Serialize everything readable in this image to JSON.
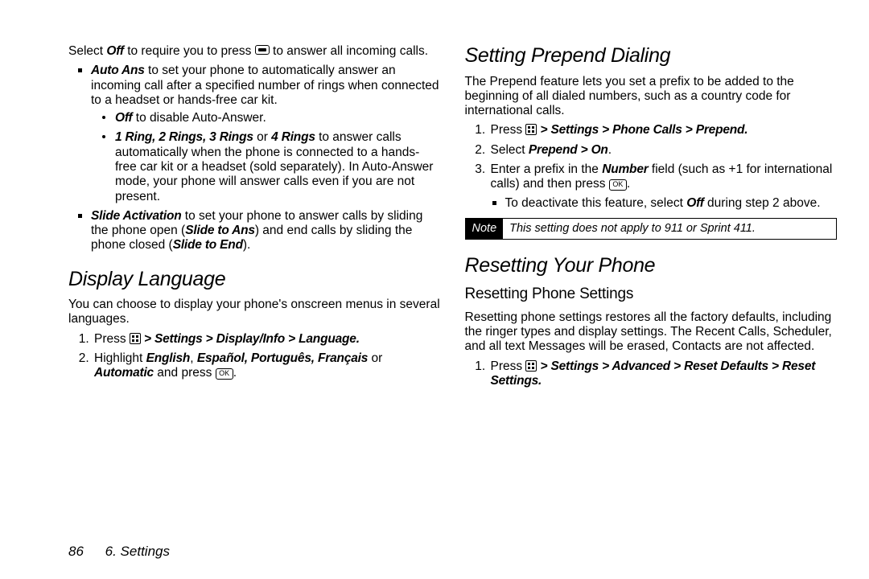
{
  "col1": {
    "select_off_pre": "Select ",
    "off_label": "Off",
    "select_off_post": " to require you to press ",
    "select_off_tail": " to answer all incoming calls.",
    "auto_ans_label": "Auto Ans",
    "auto_ans_text": " to set your phone to automatically answer an incoming call after a specified number of rings when connected to a headset or hands-free car kit.",
    "sub_off_label": "Off",
    "sub_off_text": " to disable Auto-Answer.",
    "rings_label": "1 Ring, 2 Rings, 3 Rings",
    "rings_or": " or ",
    "rings_label2": "4 Rings",
    "rings_text": " to answer calls automatically when the phone is connected to a hands-free car kit or a headset (sold separately). In Auto-Answer mode, your phone will answer calls even if you are not present.",
    "slide_label": "Slide Activation",
    "slide_text_a": " to set your phone to answer calls by sliding the phone open (",
    "slide_ans": "Slide to Ans",
    "slide_text_b": ") and end calls by sliding the phone closed (",
    "slide_end": "Slide to End",
    "slide_text_c": ").",
    "h_display": "Display Language",
    "display_para": "You can choose to display your phone's onscreen menus in several languages.",
    "step1_pre": "Press ",
    "step1_path": " > Settings > Display/Info > Language.",
    "step2_pre": "Highlight ",
    "langs": "English",
    "langs_sep": ", ",
    "langs2": "Español, Português, Français",
    "step2_or": " or ",
    "auto": "Automatic",
    "step2_post": " and press ",
    "ok_key": "OK",
    "period": "."
  },
  "col2": {
    "h_prepend": "Setting Prepend Dialing",
    "prepend_para": "The Prepend feature lets you set a prefix to be added to the beginning of all dialed numbers, such as a country code for international calls.",
    "p_step1_pre": "Press ",
    "p_step1_path": " > Settings > Phone Calls > Prepend.",
    "p_step2_pre": "Select ",
    "p_step2_path": "Prepend > On",
    "p_step3_a": "Enter a prefix in the ",
    "number_lbl": "Number",
    "p_step3_b": " field (such as +1 for international calls) and then press ",
    "deact_a": "To deactivate this feature, select ",
    "deact_off": "Off",
    "deact_b": " during step 2 above.",
    "note_tag": "Note",
    "note_msg": "This setting does not apply to 911 or Sprint 411.",
    "h_reset": "Resetting Your Phone",
    "h_reset_sub": "Resetting Phone Settings",
    "reset_para": "Resetting phone settings restores all the factory defaults, including the ringer types and display settings. The Recent Calls, Scheduler, and all text Messages will be erased, Contacts are not affected.",
    "r_step1_pre": "Press ",
    "r_step1_path": " > Settings > Advanced > Reset Defaults > Reset Settings."
  },
  "footer": {
    "page": "86",
    "section": "6. Settings"
  }
}
